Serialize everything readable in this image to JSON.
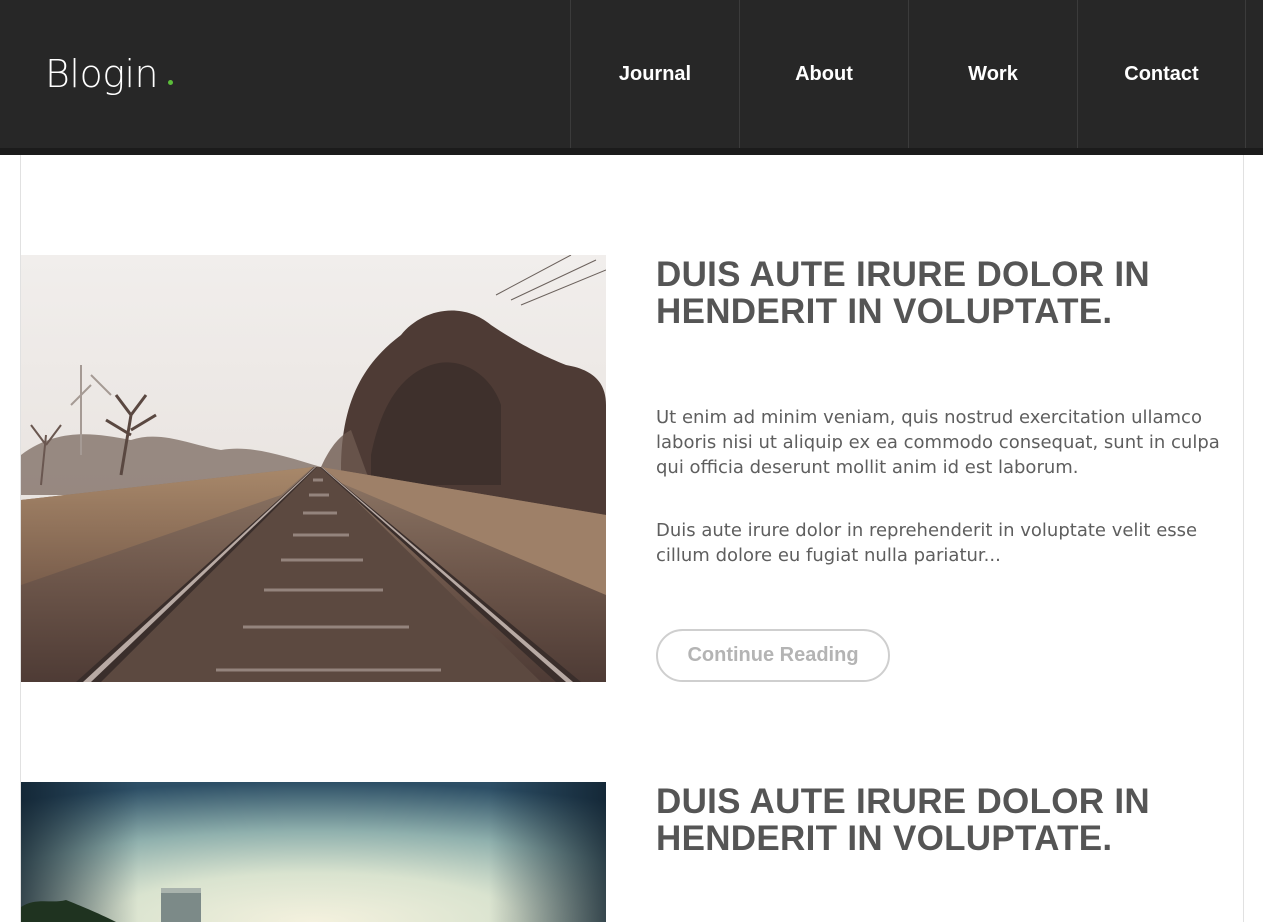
{
  "header": {
    "logo": "Blogin",
    "logo_dot_color": "#5bbd3a",
    "background": "#272727",
    "nav": [
      {
        "label": "Journal"
      },
      {
        "label": "About"
      },
      {
        "label": "Work"
      },
      {
        "label": "Contact"
      }
    ]
  },
  "posts": [
    {
      "image_alt": "railway-tracks-photo",
      "title": "DUIS AUTE IRURE DOLOR IN HENDERIT IN VOLUPTATE.",
      "paragraphs": [
        "Ut enim ad minim veniam, quis nostrud exercitation ullamco laboris nisi ut aliquip ex ea commodo consequat, sunt in culpa qui officia deserunt mollit anim id est laborum.",
        "Duis aute irure dolor in reprehenderit in voluptate velit esse cillum dolore eu fugiat nulla pariatur..."
      ],
      "button_label": "Continue Reading"
    },
    {
      "image_alt": "water-tower-sky-photo",
      "title": "DUIS AUTE IRURE DOLOR IN HENDERIT IN VOLUPTATE."
    }
  ]
}
